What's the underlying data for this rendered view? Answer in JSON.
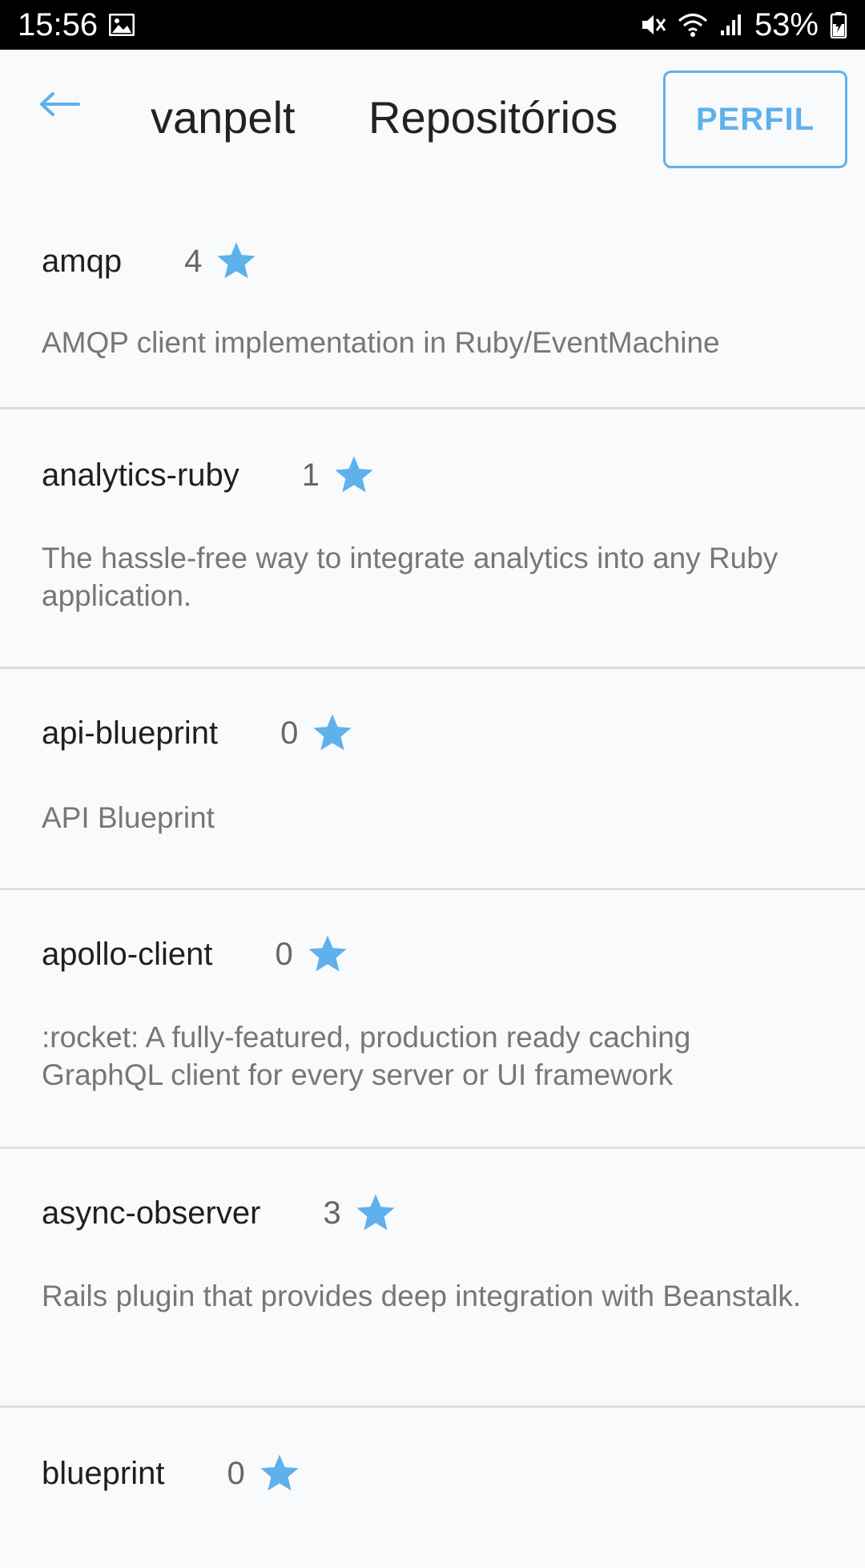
{
  "status_bar": {
    "time": "15:56",
    "battery": "53%",
    "icons": [
      "image-icon",
      "mute-icon",
      "wifi-icon",
      "signal-icon",
      "battery-icon"
    ]
  },
  "header": {
    "user": "vanpelt",
    "title": "Repositórios",
    "profile_button": "PERFIL"
  },
  "colors": {
    "accent": "#5fb1ec",
    "background": "#f9fafb",
    "divider": "#dedede"
  },
  "repos": [
    {
      "name": "amqp",
      "stars": "4",
      "description": "AMQP client implementation in Ruby/EventMachine"
    },
    {
      "name": "analytics-ruby",
      "stars": "1",
      "description": "The hassle-free way to integrate analytics into any Ruby application."
    },
    {
      "name": "api-blueprint",
      "stars": "0",
      "description": "API Blueprint"
    },
    {
      "name": "apollo-client",
      "stars": "0",
      "description": ":rocket: A fully-featured, production ready caching GraphQL client for every server or UI framework"
    },
    {
      "name": "async-observer",
      "stars": "3",
      "description": "Rails plugin that provides deep integration with Beanstalk."
    },
    {
      "name": "blueprint",
      "stars": "0",
      "description": ""
    }
  ]
}
